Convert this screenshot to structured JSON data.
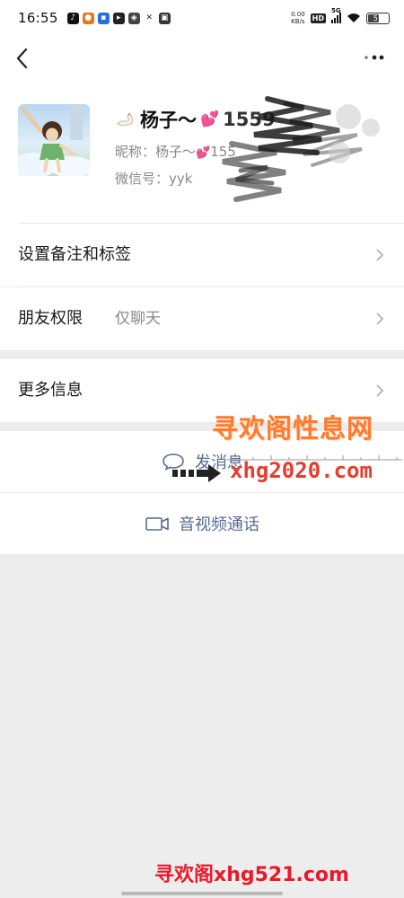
{
  "status_bar": {
    "time": "16:55",
    "app_icons": [
      "tiktok-icon",
      "halloween-app-icon",
      "sms-app-icon",
      "play-app-icon",
      "find-app-icon",
      "fitness-app-icon",
      "taobao-app-icon"
    ],
    "net_speed_value": "0.00",
    "net_speed_unit": "KB/s",
    "hd_label": "HD",
    "network_type": "5G",
    "battery_level": "55"
  },
  "profile": {
    "name": "杨子～",
    "name_emoji": "💕",
    "name_suffix_visible": "1559",
    "nickname_label": "昵称：",
    "nickname_value": "杨子～",
    "nickname_emoji": "💕",
    "nickname_suffix_visible": "155",
    "wxid_label": "微信号：",
    "wxid_value": "yyk"
  },
  "rows": {
    "remark_label": "设置备注和标签",
    "permission_label": "朋友权限",
    "permission_value": "仅聊天",
    "more_info_label": "更多信息"
  },
  "actions": {
    "message_label": "发消息",
    "call_label": "音视频通话"
  },
  "watermark": {
    "title": "寻欢阁性息网",
    "url": "xhg2020.com",
    "bottom": "寻欢阁xhg521.com"
  },
  "colors": {
    "link": "#576b95",
    "background": "#ededed",
    "watermark_orange": "#ff7b2e",
    "watermark_red": "#e53d2f"
  }
}
